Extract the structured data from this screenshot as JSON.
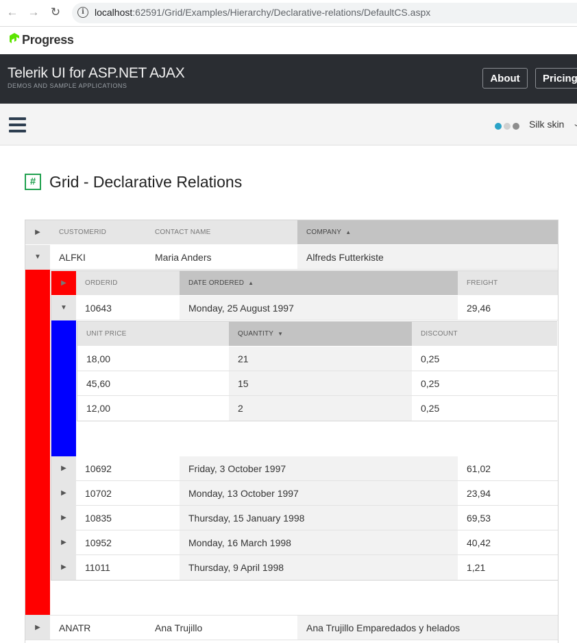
{
  "browser": {
    "url_host": "localhost",
    "url_path": ":62591/Grid/Examples/Hierarchy/Declarative-relations/DefaultCS.aspx"
  },
  "brand": {
    "logo_text": "Progress",
    "title": "Telerik UI for ASP.NET AJAX",
    "subtitle": "DEMOS AND SAMPLE APPLICATIONS"
  },
  "header_buttons": {
    "about": "About",
    "pricing": "Pricing"
  },
  "toolbar": {
    "skin_label": "Silk skin",
    "skin_dot_colors": [
      "#2aa3c7",
      "#d0d0d0",
      "#8d8d8d"
    ]
  },
  "page": {
    "title": "Grid - Declarative Relations"
  },
  "colors": {
    "level1_marker": "#ff0000",
    "level2_marker": "#0000ff",
    "sorted_header": "#c3c3c3",
    "icon_green": "#1fa04e"
  },
  "customers": {
    "headers": {
      "customer_id": "CUSTOMERID",
      "contact_name": "CONTACT NAME",
      "company": "COMPANY"
    },
    "sorted_column": "company",
    "rows": [
      {
        "customer_id": "ALFKI",
        "contact_name": "Maria Anders",
        "company": "Alfreds Futterkiste",
        "expanded": true
      },
      {
        "customer_id": "ANATR",
        "contact_name": "Ana Trujillo",
        "company": "Ana Trujillo Emparedados y helados",
        "expanded": false
      }
    ]
  },
  "orders": {
    "headers": {
      "order_id": "ORDERID",
      "date_ordered": "DATE ORDERED",
      "freight": "FREIGHT"
    },
    "sorted_column": "date_ordered",
    "rows": [
      {
        "order_id": "10643",
        "date": "Monday, 25 August 1997",
        "freight": "29,46",
        "expanded": true
      },
      {
        "order_id": "10692",
        "date": "Friday, 3 October 1997",
        "freight": "61,02"
      },
      {
        "order_id": "10702",
        "date": "Monday, 13 October 1997",
        "freight": "23,94"
      },
      {
        "order_id": "10835",
        "date": "Thursday, 15 January 1998",
        "freight": "69,53"
      },
      {
        "order_id": "10952",
        "date": "Monday, 16 March 1998",
        "freight": "40,42"
      },
      {
        "order_id": "11011",
        "date": "Thursday, 9 April 1998",
        "freight": "1,21"
      }
    ]
  },
  "details": {
    "headers": {
      "unit_price": "UNIT PRICE",
      "quantity": "QUANTITY",
      "discount": "DISCOUNT"
    },
    "sorted_column": "quantity",
    "rows": [
      {
        "unit_price": "18,00",
        "quantity": "21",
        "discount": "0,25"
      },
      {
        "unit_price": "45,60",
        "quantity": "15",
        "discount": "0,25"
      },
      {
        "unit_price": "12,00",
        "quantity": "2",
        "discount": "0,25"
      }
    ]
  }
}
